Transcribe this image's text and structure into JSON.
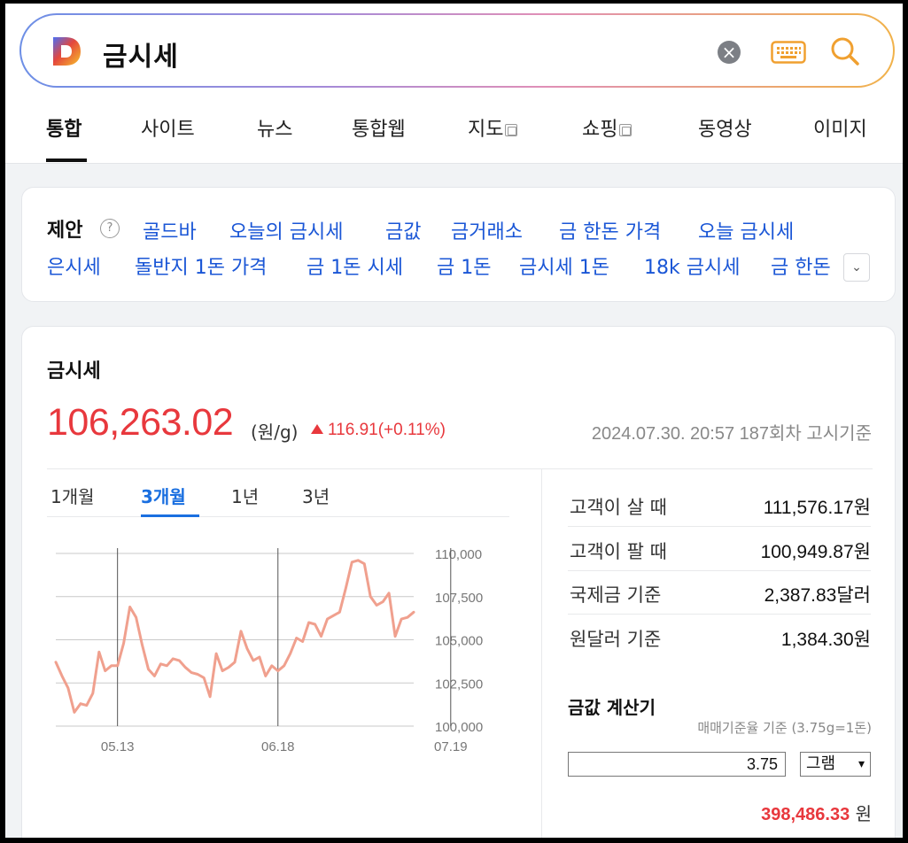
{
  "search": {
    "query": "금시세"
  },
  "tabs": [
    {
      "label": "통합"
    },
    {
      "label": "사이트"
    },
    {
      "label": "뉴스"
    },
    {
      "label": "통합웹"
    },
    {
      "label": "지도"
    },
    {
      "label": "쇼핑"
    },
    {
      "label": "동영상"
    },
    {
      "label": "이미지"
    }
  ],
  "suggest": {
    "title": "제안",
    "help": "?",
    "row1": [
      "골드바",
      "오늘의 금시세",
      "금값",
      "금거래소",
      "금 한돈 가격",
      "오늘 금시세"
    ],
    "row2": [
      "은시세",
      "돌반지 1돈 가격",
      "금 1돈 시세",
      "금 1돈",
      "금시세 1돈",
      "18k 금시세",
      "금 한돈"
    ]
  },
  "gold": {
    "title": "금시세",
    "price": "106,263.02",
    "unit": "(원/g)",
    "change": "116.91(+0.11%)",
    "date": "2024.07.30. 20:57 187회차 고시기준",
    "periods": [
      "1개월",
      "3개월",
      "1년",
      "3년"
    ],
    "active_period": "3개월",
    "rates": [
      {
        "label": "고객이 살 때",
        "value": "111,576.17원"
      },
      {
        "label": "고객이 팔 때",
        "value": "100,949.87원"
      },
      {
        "label": "국제금 기준",
        "value": "2,387.83달러"
      },
      {
        "label": "원달러 기준",
        "value": "1,384.30원"
      }
    ],
    "calc": {
      "title": "금값 계산기",
      "note": "매매기준율 기준 (3.75g=1돈)",
      "input": "3.75",
      "unit_select": "그램",
      "result": "398,486.33",
      "result_unit": "원"
    }
  },
  "colors": {
    "up": "#e8383d",
    "link": "#1a56d6",
    "accent": "#1a6fe0",
    "line": "#f0a08e"
  },
  "chart_data": {
    "type": "line",
    "xticks": [
      "05.13",
      "06.18",
      "07.19"
    ],
    "xtick_index": [
      10,
      36,
      64
    ],
    "ylim": [
      100000,
      110000
    ],
    "yticks": [
      "110,000",
      "107,500",
      "105,000",
      "102,500",
      "100,000"
    ],
    "series": [
      {
        "values": [
          103700,
          102900,
          102200,
          100800,
          101300,
          101200,
          101900,
          104300,
          103200,
          103500,
          103500,
          104800,
          106900,
          106300,
          104700,
          103300,
          102900,
          103600,
          103500,
          103900,
          103800,
          103400,
          103100,
          103000,
          102800,
          101700,
          104200,
          103200,
          103400,
          103700,
          105500,
          104500,
          103800,
          104000,
          102900,
          103500,
          103200,
          103500,
          104200,
          105100,
          104900,
          106000,
          105900,
          105200,
          106200,
          106400,
          106600,
          108000,
          109500,
          109600,
          109400,
          107500,
          107000,
          107200,
          107700,
          105200,
          106200,
          106300,
          106600
        ]
      }
    ]
  }
}
